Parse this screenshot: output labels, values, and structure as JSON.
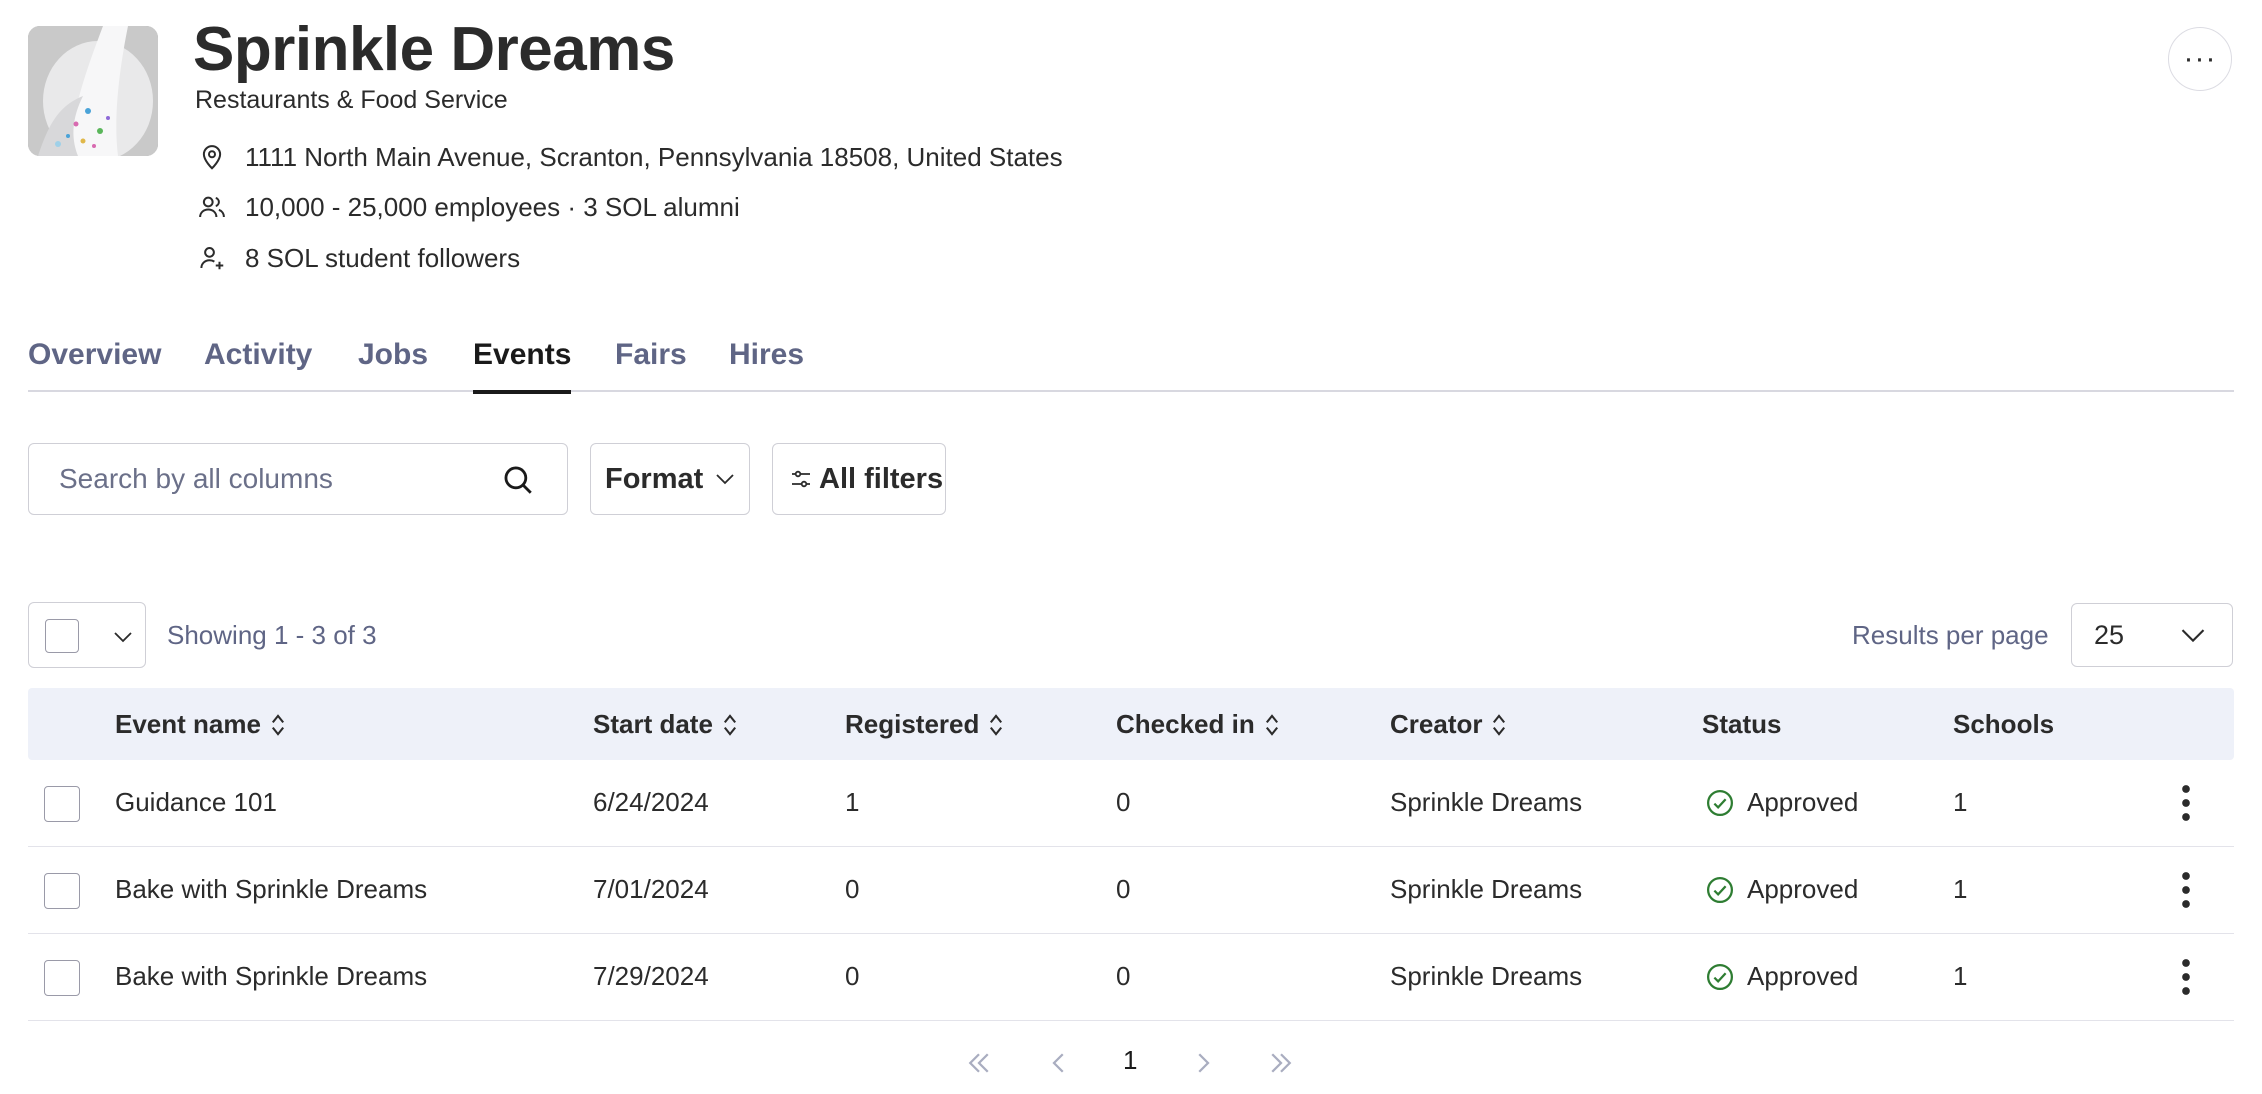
{
  "company": {
    "name": "Sprinkle Dreams",
    "category": "Restaurants & Food Service",
    "address": "1111 North Main Avenue, Scranton, Pennsylvania 18508, United States",
    "employees": "10,000 - 25,000 employees · 3 SOL alumni",
    "followers": "8 SOL student followers",
    "more_label": "···"
  },
  "tabs": [
    {
      "label": "Overview",
      "active": false
    },
    {
      "label": "Activity",
      "active": false
    },
    {
      "label": "Jobs",
      "active": false
    },
    {
      "label": "Events",
      "active": true
    },
    {
      "label": "Fairs",
      "active": false
    },
    {
      "label": "Hires",
      "active": false
    }
  ],
  "toolbar": {
    "search_placeholder": "Search by all columns",
    "format_label": "Format",
    "filters_label": "All filters"
  },
  "results": {
    "showing": "Showing 1 - 3 of 3",
    "per_page_label": "Results per page",
    "per_page_value": "25"
  },
  "table": {
    "columns": [
      "Event name",
      "Start date",
      "Registered",
      "Checked in",
      "Creator",
      "Status",
      "Schools"
    ],
    "rows": [
      {
        "event": "Guidance 101",
        "start": "6/24/2024",
        "registered": "1",
        "checked_in": "0",
        "creator": "Sprinkle Dreams",
        "status": "Approved",
        "schools": "1"
      },
      {
        "event": "Bake with Sprinkle Dreams",
        "start": "7/01/2024",
        "registered": "0",
        "checked_in": "0",
        "creator": "Sprinkle Dreams",
        "status": "Approved",
        "schools": "1"
      },
      {
        "event": "Bake with Sprinkle Dreams",
        "start": "7/29/2024",
        "registered": "0",
        "checked_in": "0",
        "creator": "Sprinkle Dreams",
        "status": "Approved",
        "schools": "1"
      }
    ]
  },
  "pagination": {
    "current_page": "1"
  },
  "colors": {
    "status_approved": "#2e7d32",
    "tab_inactive": "#5f6585",
    "header_bg": "#eef1f9"
  },
  "icons": {
    "address": "location-pin-icon",
    "employees": "people-icon",
    "followers": "person-add-icon",
    "search": "search-icon",
    "status": "check-circle-icon"
  }
}
